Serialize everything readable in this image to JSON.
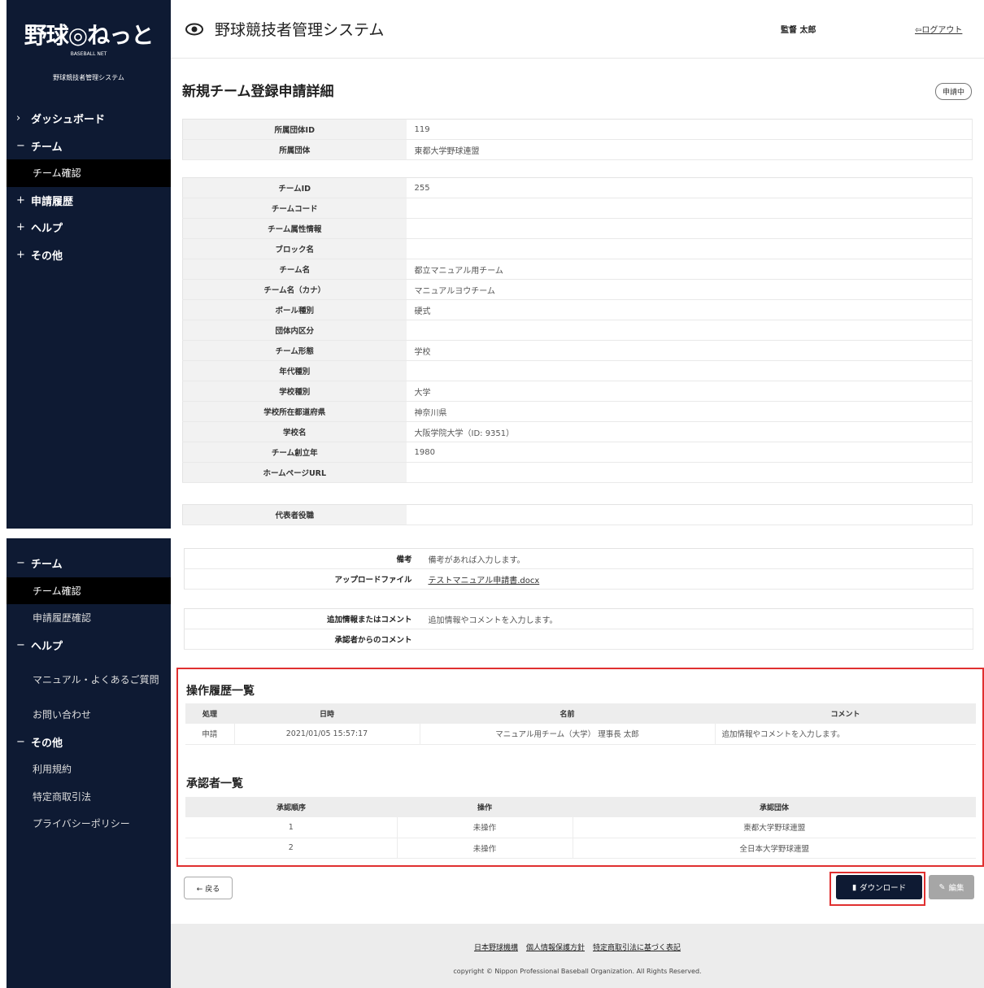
{
  "app": {
    "logo_text": "野球◎ねっと",
    "logo_sub": "BASEBALL NET",
    "logo_caption": "野球競技者管理システム",
    "header_title": "野球競技者管理システム",
    "user_name": "監督 太郎",
    "logout_label": "ログアウト"
  },
  "sidebar_top": [
    {
      "mark": "›",
      "label": "ダッシュボード"
    },
    {
      "mark": "−",
      "label": "チーム"
    },
    {
      "sub": true,
      "active": true,
      "label": "チーム確認"
    },
    {
      "mark": "+",
      "label": "申請履歴"
    },
    {
      "mark": "+",
      "label": "ヘルプ"
    },
    {
      "mark": "+",
      "label": "その他"
    }
  ],
  "sidebar_bottom": [
    {
      "mark": "−",
      "label": "チーム"
    },
    {
      "sub": true,
      "active": true,
      "label": "チーム確認"
    },
    {
      "sub": true,
      "label": "申請履歴確認"
    },
    {
      "mark": "−",
      "label": "ヘルプ"
    },
    {
      "sub": true,
      "tall": true,
      "label": "マニュアル・よくあるご質問"
    },
    {
      "sub": true,
      "label": "お問い合わせ"
    },
    {
      "mark": "−",
      "label": "その他"
    },
    {
      "sub": true,
      "label": "利用規約"
    },
    {
      "sub": true,
      "label": "特定商取引法"
    },
    {
      "sub": true,
      "label": "プライバシーポリシー"
    }
  ],
  "page": {
    "title": "新規チーム登録申請詳細",
    "status": "申請中"
  },
  "org_table": [
    {
      "label": "所属団体ID",
      "value": "119"
    },
    {
      "label": "所属団体",
      "value": "東都大学野球連盟"
    }
  ],
  "team_table": [
    {
      "label": "チームID",
      "value": "255"
    },
    {
      "label": "チームコード",
      "value": ""
    },
    {
      "label": "チーム属性情報",
      "value": ""
    },
    {
      "label": "ブロック名",
      "value": ""
    },
    {
      "label": "チーム名",
      "value": "都立マニュアル用チーム"
    },
    {
      "label": "チーム名（カナ）",
      "value": "マニュアルヨウチーム"
    },
    {
      "label": "ボール種別",
      "value": "硬式"
    },
    {
      "label": "団体内区分",
      "value": ""
    },
    {
      "label": "チーム形態",
      "value": "学校"
    },
    {
      "label": "年代種別",
      "value": ""
    },
    {
      "label": "学校種別",
      "value": "大学"
    },
    {
      "label": "学校所在都道府県",
      "value": "神奈川県"
    },
    {
      "label": "学校名",
      "value": "大阪学院大学（ID: 9351）"
    },
    {
      "label": "チーム創立年",
      "value": "1980"
    },
    {
      "label": "ホームページURL",
      "value": ""
    }
  ],
  "rep_table": [
    {
      "label": "代表者役職",
      "value": ""
    }
  ],
  "notes": {
    "remarks_label": "備考",
    "remarks_value": "備考があれば入力します。",
    "upload_label": "アップロードファイル",
    "upload_value": "テストマニュアル申請書.docx",
    "comment_label": "追加情報またはコメント",
    "comment_value": "追加情報やコメントを入力します。",
    "approver_comment_label": "承認者からのコメント",
    "approver_comment_value": ""
  },
  "history": {
    "title": "操作履歴一覧",
    "headers": [
      "処理",
      "日時",
      "名前",
      "コメント"
    ],
    "rows": [
      [
        "申請",
        "2021/01/05 15:57:17",
        "マニュアル用チーム（大学） 理事長 太郎",
        "追加情報やコメントを入力します。"
      ]
    ]
  },
  "approvers": {
    "title": "承認者一覧",
    "headers": [
      "承認順序",
      "操作",
      "承認団体"
    ],
    "rows": [
      [
        "1",
        "未操作",
        "東都大学野球連盟"
      ],
      [
        "2",
        "未操作",
        "全日本大学野球連盟"
      ]
    ]
  },
  "buttons": {
    "back": "← 戻る",
    "download": "ダウンロード",
    "edit": "編集"
  },
  "footer": {
    "links": [
      "日本野球機構",
      "個人情報保護方針",
      "特定商取引法に基づく表記"
    ],
    "copyright": "copyright © Nippon Professional Baseball Organization. All Rights Reserved."
  }
}
